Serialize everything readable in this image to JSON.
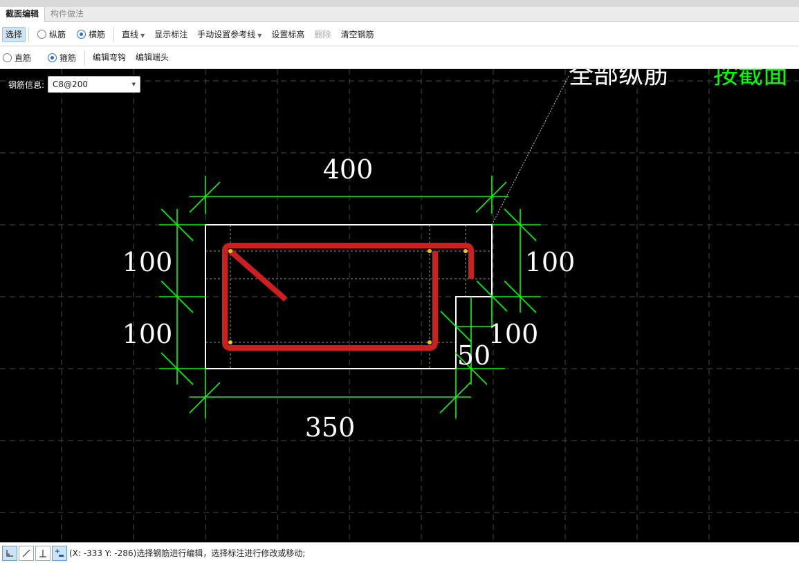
{
  "tabs": [
    {
      "label": "截面编辑",
      "active": true
    },
    {
      "label": "构件做法",
      "active": false
    }
  ],
  "toolbar1": {
    "select_label": "选择",
    "longitudinal_label": "纵筋",
    "transverse_label": "横筋",
    "line_mode_label": "直线",
    "show_dims_label": "显示标注",
    "manual_ref_label": "手动设置参考线",
    "set_elevation_label": "设置标高",
    "delete_label": "删除",
    "clear_rebar_label": "清空钢筋"
  },
  "toolbar2": {
    "straight_bar_label": "直筋",
    "stirrup_label": "箍筋",
    "edit_hook_label": "编辑弯钩",
    "edit_end_label": "编辑端头"
  },
  "rebar_info": {
    "label": "钢筋信息:",
    "value": "C8@200"
  },
  "canvas": {
    "callout_white": "全部纵筋",
    "callout_green": "按截面",
    "dim_top": "400",
    "dim_left_upper": "100",
    "dim_left_lower": "100",
    "dim_right_upper": "100",
    "dim_right_lower": "100",
    "dim_notch": "50",
    "dim_bottom": "350",
    "colors": {
      "background": "#000000",
      "outline": "#ffffff",
      "dimension": "#00ff00",
      "rebar": "#cc1f1f",
      "node": "#f5c400",
      "grid": "#4a4a4a"
    }
  },
  "status": {
    "text": "(X: -333 Y: -286)选择钢筋进行编辑，选择标注进行修改或移动;"
  }
}
